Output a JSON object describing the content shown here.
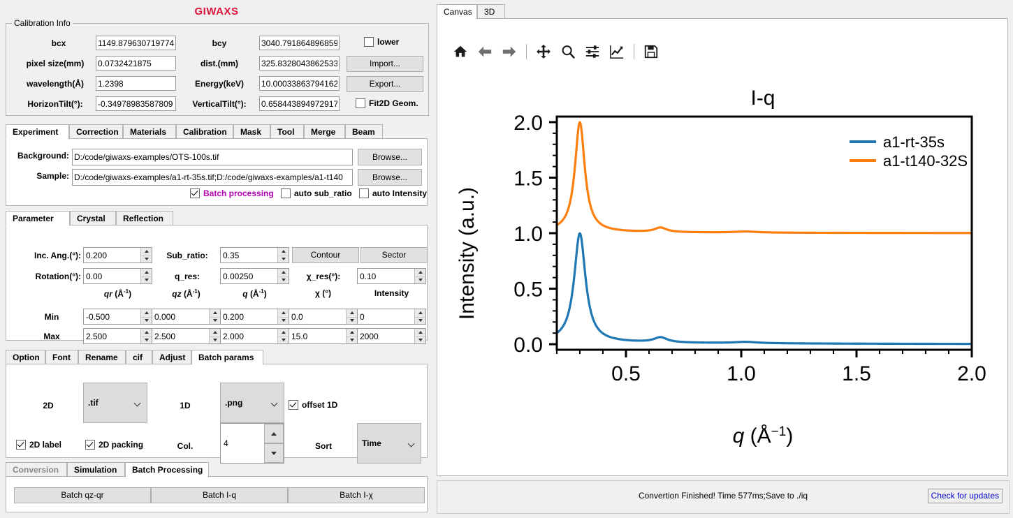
{
  "app": {
    "title": "GIWAXS",
    "title_color": "#dc143c"
  },
  "calibration": {
    "legend": "Calibration Info",
    "fields": [
      {
        "label": "bcx",
        "value": "1149.879630719774"
      },
      {
        "label": "bcy",
        "value": "3040.791864896859"
      },
      {
        "label": "pixel size(mm)",
        "value": "0.0732421875"
      },
      {
        "label": "dist.(mm)",
        "value": "325.8328043862533"
      },
      {
        "label": "wavelength(Å)",
        "value": "1.2398"
      },
      {
        "label": "Energy(keV)",
        "value": "10.00033863794162"
      },
      {
        "label": "HorizonTilt(°):",
        "value": "-0.34978983587809"
      },
      {
        "label": "VerticalTilt(°):",
        "value": "0.658443894972917"
      }
    ],
    "lower_checkbox": {
      "label": "lower",
      "checked": false
    },
    "fit2d_checkbox": {
      "label": "Fit2D Geom.",
      "checked": false
    },
    "import_button": "Import...",
    "export_button": "Export..."
  },
  "experiment": {
    "tabs": [
      "Experiment",
      "Correction",
      "Materials",
      "Calibration",
      "Mask",
      "Tool",
      "Merge",
      "Beam"
    ],
    "selected_tab": "Experiment",
    "background_label": "Background:",
    "background_value": "D:/code/giwaxs-examples/OTS-100s.tif",
    "sample_label": "Sample:",
    "sample_value": "D:/code/giwaxs-examples/a1-rt-35s.tif;D:/code/giwaxs-examples/a1-t140",
    "browse_label": "Browse...",
    "checks": [
      {
        "label": "Batch processing",
        "checked": true,
        "color": "#b300b3"
      },
      {
        "label": "auto sub_ratio",
        "checked": false,
        "color": "#000000"
      },
      {
        "label": "auto Intensity",
        "checked": false,
        "color": "#000000"
      }
    ]
  },
  "parameter": {
    "tabs": [
      "Parameter",
      "Crystal",
      "Reflection"
    ],
    "selected_tab": "Parameter",
    "inc_ang_label": "Inc. Ang.(°):",
    "inc_ang_value": "0.200",
    "sub_ratio_label": "Sub_ratio:",
    "sub_ratio_value": "0.35",
    "contour_button": "Contour",
    "sector_button": "Sector",
    "rotation_label": "Rotation(°):",
    "rotation_value": "0.00",
    "q_res_label": "q_res:",
    "q_res_value": "0.00250",
    "chi_res_label": "χ_res(°):",
    "chi_res_value": "0.10",
    "column_headers": [
      "qr",
      "qz",
      "q",
      "χ",
      "Intensity"
    ],
    "column_units": [
      "(Å-1)",
      "(Å-1)",
      "(Å-1)",
      "(°)",
      ""
    ],
    "row_min_label": "Min",
    "row_max_label": "Max",
    "min_values": [
      "-0.500",
      "0.000",
      "0.200",
      "0.0",
      "0"
    ],
    "max_values": [
      "2.500",
      "2.500",
      "2.000",
      "15.0",
      "2000"
    ]
  },
  "batch_params": {
    "tabs": [
      "Option",
      "Font",
      "Rename",
      "cif",
      "Adjust",
      "Batch params"
    ],
    "selected_tab": "Batch params",
    "label_2d": "2D",
    "format_2d": ".tif",
    "label_1d": "1D",
    "format_1d": ".png",
    "offset_1d": {
      "label": "offset 1D",
      "checked": true
    },
    "label_2d_chk": {
      "label": "2D label",
      "checked": true
    },
    "packing_2d_chk": {
      "label": "2D packing",
      "checked": true
    },
    "col_label": "Col.",
    "col_value": "4",
    "sort_label": "Sort",
    "sort_value": "Time"
  },
  "bottom": {
    "tabs": [
      "Conversion",
      "Simulation",
      "Batch Processing"
    ],
    "selected_tab": "Batch Processing",
    "disabled_tab": "Conversion",
    "buttons": [
      "Batch qz-qr",
      "Batch I-q",
      "Batch I-χ"
    ]
  },
  "canvas": {
    "tabs": [
      "Canvas",
      "3D"
    ],
    "selected_tab": "Canvas",
    "toolbar_icons": [
      "home-icon",
      "back-arrow-icon",
      "forward-arrow-icon",
      "pan-move-icon",
      "zoom-magnifier-icon",
      "configure-subplots-icon",
      "axis-curve-icon",
      "save-disk-icon"
    ]
  },
  "status": {
    "message": "Convertion Finished! Time 577ms;Save to ./iq",
    "update_button": "Check for updates"
  },
  "chart_data": {
    "type": "line",
    "title": "I-q",
    "xlabel": "q (Å-1)",
    "ylabel": "Intensity (a.u.)",
    "xlim": [
      0.2,
      2.0
    ],
    "ylim": [
      -0.05,
      2.05
    ],
    "xticks": [
      0.5,
      1.0,
      1.5,
      2.0
    ],
    "yticks": [
      0.0,
      0.5,
      1.0,
      1.5,
      2.0
    ],
    "grid": false,
    "legend_position": "upper right",
    "series": [
      {
        "name": "a1-rt-35s",
        "color": "#1f77b4",
        "offset": 0.0,
        "baseline": 0.02,
        "peaks": [
          {
            "q": 0.3,
            "height": 0.98,
            "width": 0.03
          },
          {
            "q": 0.65,
            "height": 0.045,
            "width": 0.035
          },
          {
            "q": 1.02,
            "height": 0.012,
            "width": 0.06
          }
        ]
      },
      {
        "name": "a1-t140-32S",
        "color": "#ff7f0e",
        "offset": 1.0,
        "baseline": 0.01,
        "peaks": [
          {
            "q": 0.3,
            "height": 0.99,
            "width": 0.026
          },
          {
            "q": 0.65,
            "height": 0.04,
            "width": 0.032
          },
          {
            "q": 1.02,
            "height": 0.01,
            "width": 0.06
          }
        ]
      }
    ]
  }
}
